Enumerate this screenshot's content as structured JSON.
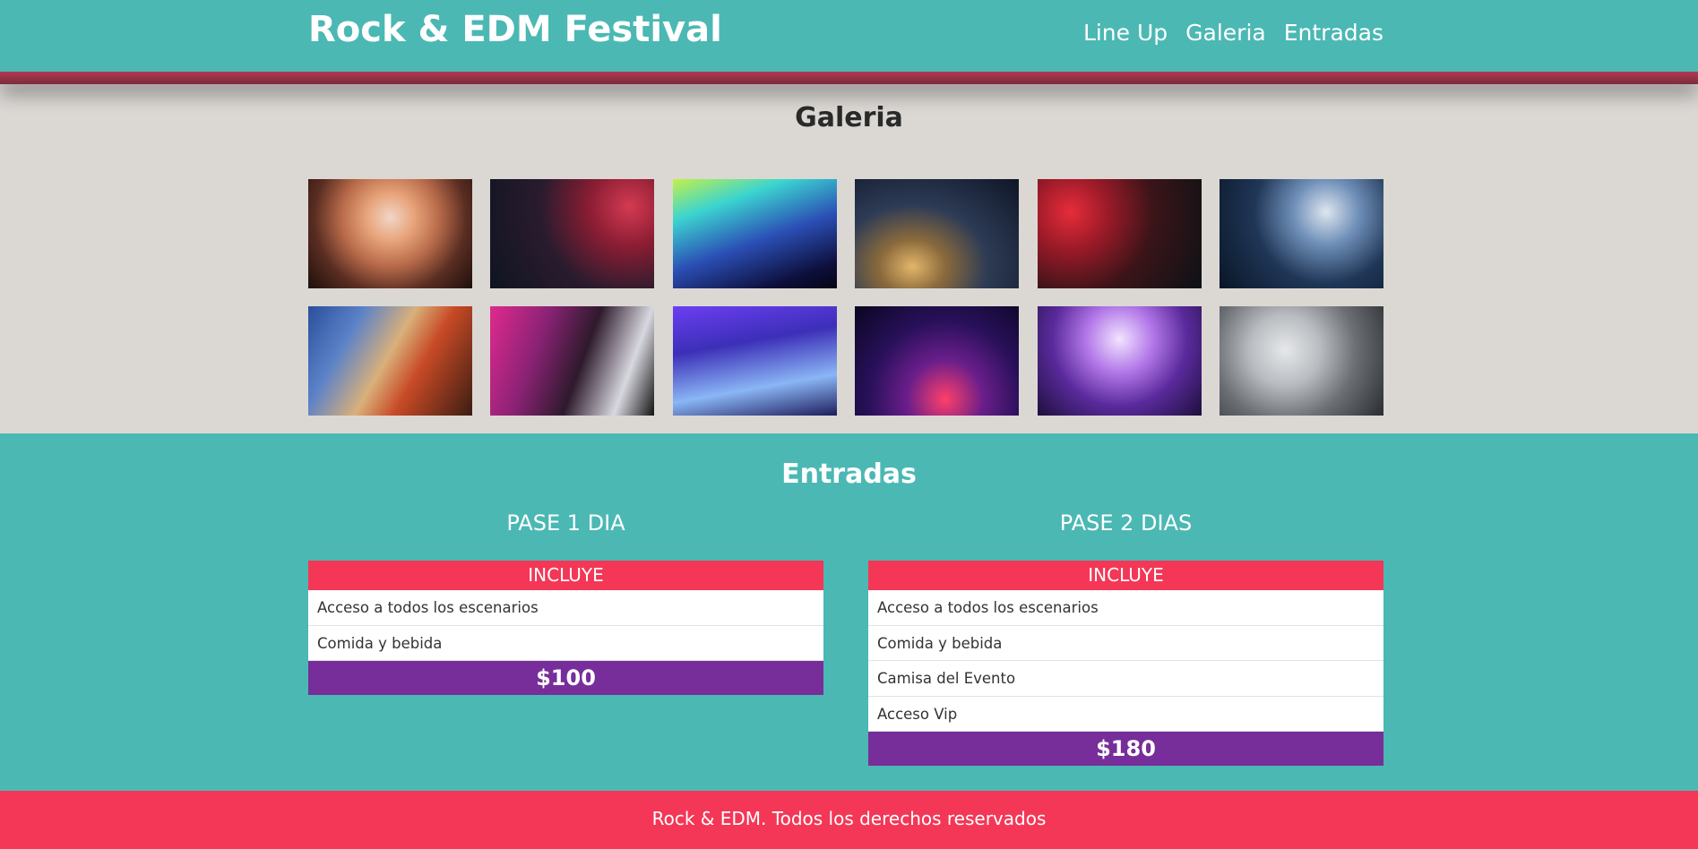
{
  "header": {
    "title": "Rock & EDM Festival",
    "nav": [
      "Line Up",
      "Galeria",
      "Entradas"
    ]
  },
  "gallery": {
    "title": "Galeria",
    "photos": [
      "crowd-photo",
      "singer-photo",
      "concert-lights-photo",
      "turntable-photo",
      "guitarist-photo",
      "dj-photo",
      "guitars-photo",
      "dj-laptop-photo",
      "dj-mixer-photo",
      "dj-console-photo",
      "band-photo",
      "smoke-performer-photo"
    ]
  },
  "tickets": {
    "title": "Entradas",
    "plans": [
      {
        "name": "PASE 1 DIA",
        "includes_label": "INCLUYE",
        "items": [
          "Acceso a todos los escenarios",
          "Comida y bebida"
        ],
        "price": "$100"
      },
      {
        "name": "PASE 2 DIAS",
        "includes_label": "INCLUYE",
        "items": [
          "Acceso a todos los escenarios",
          "Comida y bebida",
          "Camisa del Evento",
          "Acceso Vip"
        ],
        "price": "$180"
      }
    ]
  },
  "footer": {
    "text": "Rock & EDM. Todos los derechos reservados"
  },
  "colors": {
    "teal": "#4bb8b4",
    "pink": "#f43756",
    "purple": "#772e9a",
    "background": "#dbd8d4"
  }
}
